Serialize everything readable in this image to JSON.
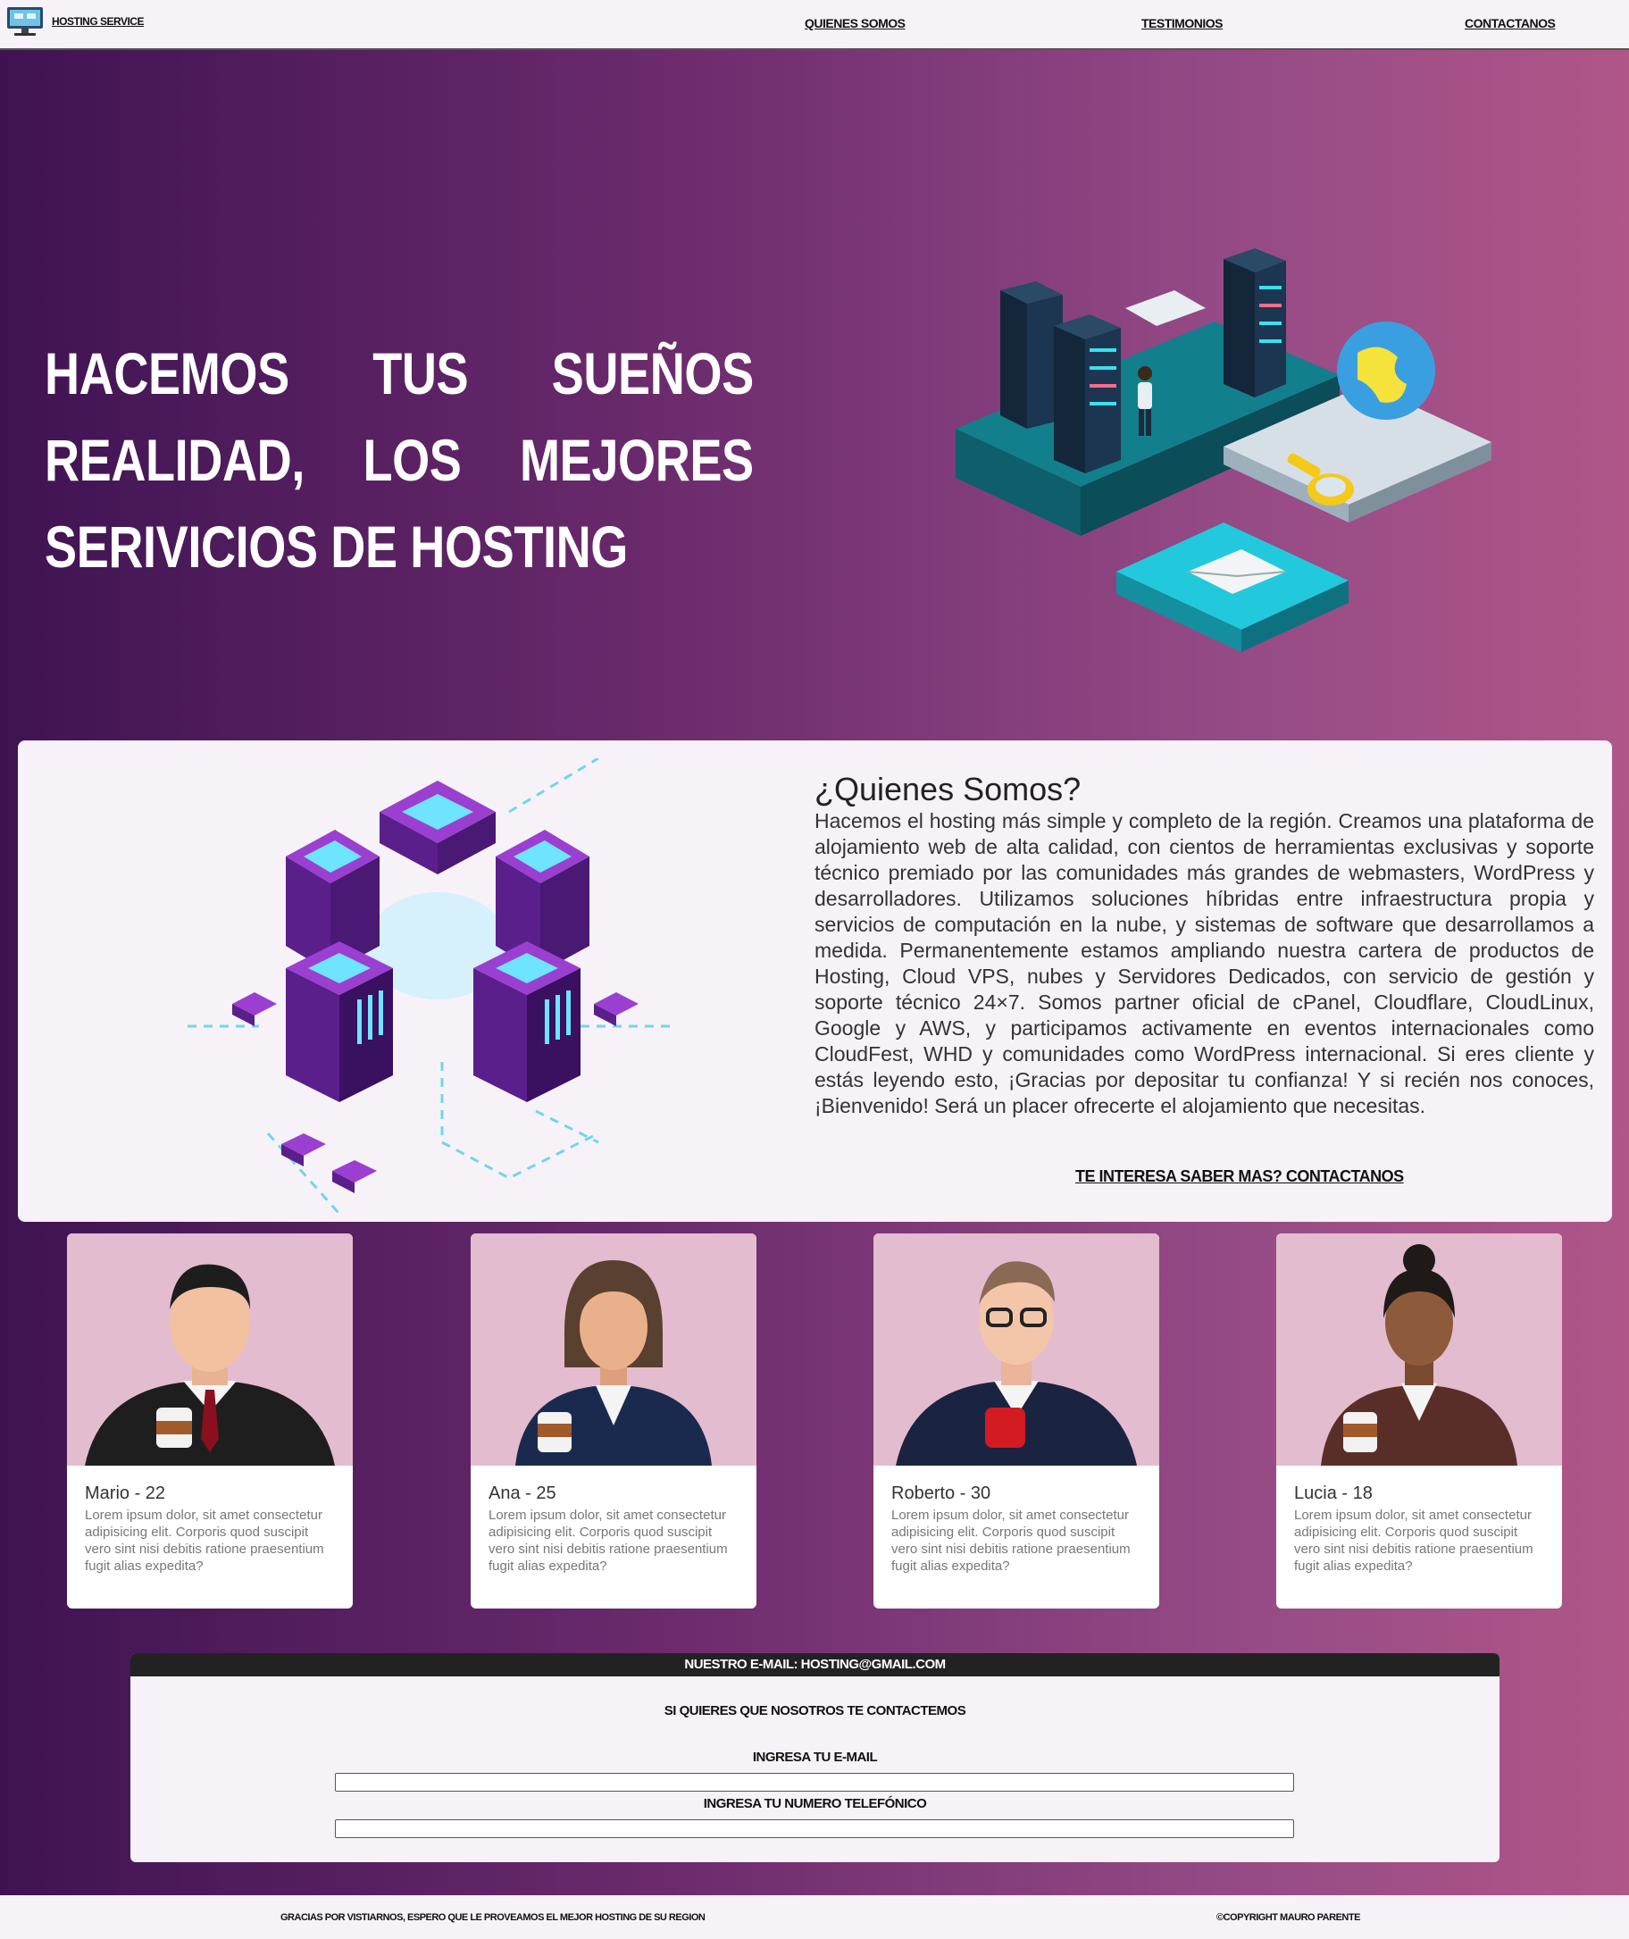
{
  "nav": {
    "brand": "HOSTING SERVICE",
    "links": [
      "QUIENES SOMOS",
      "TESTIMONIOS",
      "CONTACTANOS"
    ]
  },
  "hero": {
    "title": "HACEMOS TUS SUEÑOS REALIDAD, LOS MEJORES SERIVICIOS DE HOSTING"
  },
  "about": {
    "title": "¿Quienes Somos?",
    "body": "Hacemos el hosting más simple y completo de la región. Creamos una plataforma de alojamiento web de alta calidad, con cientos de herramientas exclusivas y soporte técnico premiado por las comunidades más grandes de webmasters, WordPress y desarrolladores. Utilizamos soluciones híbridas entre infraestructura propia y servicios de computación en la nube, y sistemas de software que desarrollamos a medida. Permanentemente estamos ampliando nuestra cartera de productos de Hosting, Cloud VPS, nubes y Servidores Dedicados, con servicio de gestión y soporte técnico 24×7. Somos partner oficial de cPanel, Cloudflare, CloudLinux, Google y AWS, y participamos activamente en eventos internacionales como CloudFest, WHD y comunidades como WordPress internacional. Si eres cliente y estás leyendo esto, ¡Gracias por depositar tu confianza! Y si recién nos conoces, ¡Bienvenido! Será un placer ofrecerte el alojamiento que necesitas.",
    "link": "TE INTERESA SABER MAS? CONTACTANOS"
  },
  "testimonials": [
    {
      "name": "Mario - 22",
      "text": "Lorem ipsum dolor, sit amet consectetur adipisicing elit. Corporis quod suscipit vero sint nisi debitis ratione praesentium fugit alias expedita?"
    },
    {
      "name": "Ana - 25",
      "text": "Lorem ipsum dolor, sit amet consectetur adipisicing elit. Corporis quod suscipit vero sint nisi debitis ratione praesentium fugit alias expedita?"
    },
    {
      "name": "Roberto - 30",
      "text": "Lorem ipsum dolor, sit amet consectetur adipisicing elit. Corporis quod suscipit vero sint nisi debitis ratione praesentium fugit alias expedita?"
    },
    {
      "name": "Lucia - 18",
      "text": "Lorem ipsum dolor, sit amet consectetur adipisicing elit. Corporis quod suscipit vero sint nisi debitis ratione praesentium fugit alias expedita?"
    }
  ],
  "contact": {
    "header": "NUESTRO E-MAIL: HOSTING@GMAIL.COM",
    "subtitle": "SI QUIERES QUE NOSOTROS TE CONTACTEMOS",
    "email_label": "INGRESA TU E-MAIL",
    "email_value": "",
    "phone_label": "INGRESA TU NUMERO TELEFÓNICO",
    "phone_value": ""
  },
  "footer": {
    "left": "GRACIAS POR VISTIARNOS, ESPERO QUE LE PROVEAMOS EL MEJOR HOSTING DE SU REGION",
    "right": "©COPYRIGHT MAURO PARENTE"
  },
  "colors": {
    "gradient_start": "#3f1352",
    "gradient_end": "#b05689",
    "card_photo_bg": "#e3bccf",
    "panel_bg": "#f7f2f7"
  },
  "icons": [
    "computer-monitor-icon"
  ]
}
